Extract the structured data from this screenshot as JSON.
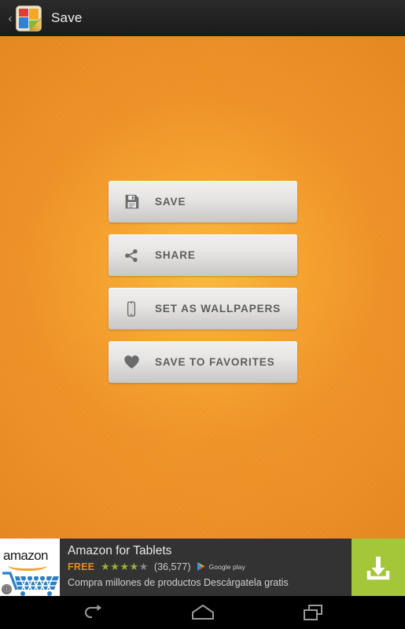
{
  "window": {
    "app_icon_name": "collage-app-icon",
    "title": "Save",
    "up_caret": "‹"
  },
  "theme": {
    "background_orange": "#ef9127",
    "actionbar_dark": "#222222",
    "accent_underline": "#e8892a",
    "button_face_top": "#f0efee",
    "button_face_bottom": "#c9c8c7",
    "cta_green": "#a4c639",
    "free_orange": "#e08c28",
    "star_on": "#9aae3b",
    "star_off": "#8a8a8a"
  },
  "actions": [
    {
      "icon": "floppy-disk-save-icon",
      "label": "SAVE"
    },
    {
      "icon": "share-nodes-icon",
      "label": "SHARE"
    },
    {
      "icon": "smartphone-icon",
      "label": "SET AS WALLPAPERS"
    },
    {
      "icon": "heart-icon",
      "label": "SAVE TO FAVORITES"
    }
  ],
  "ad": {
    "brand_word": "amazon",
    "info_badge": "ⓘ",
    "title": "Amazon for Tablets",
    "price": "FREE",
    "stars_filled": "★★★★",
    "stars_empty": "★",
    "rating_count": "(36,577)",
    "store_label": "Google play",
    "subtitle": "Compra millones de productos Descárgatela gratis",
    "cta_icon": "download-icon"
  },
  "navbar": {
    "back": "back-icon",
    "home": "home-icon",
    "recents": "recent-apps-icon"
  }
}
